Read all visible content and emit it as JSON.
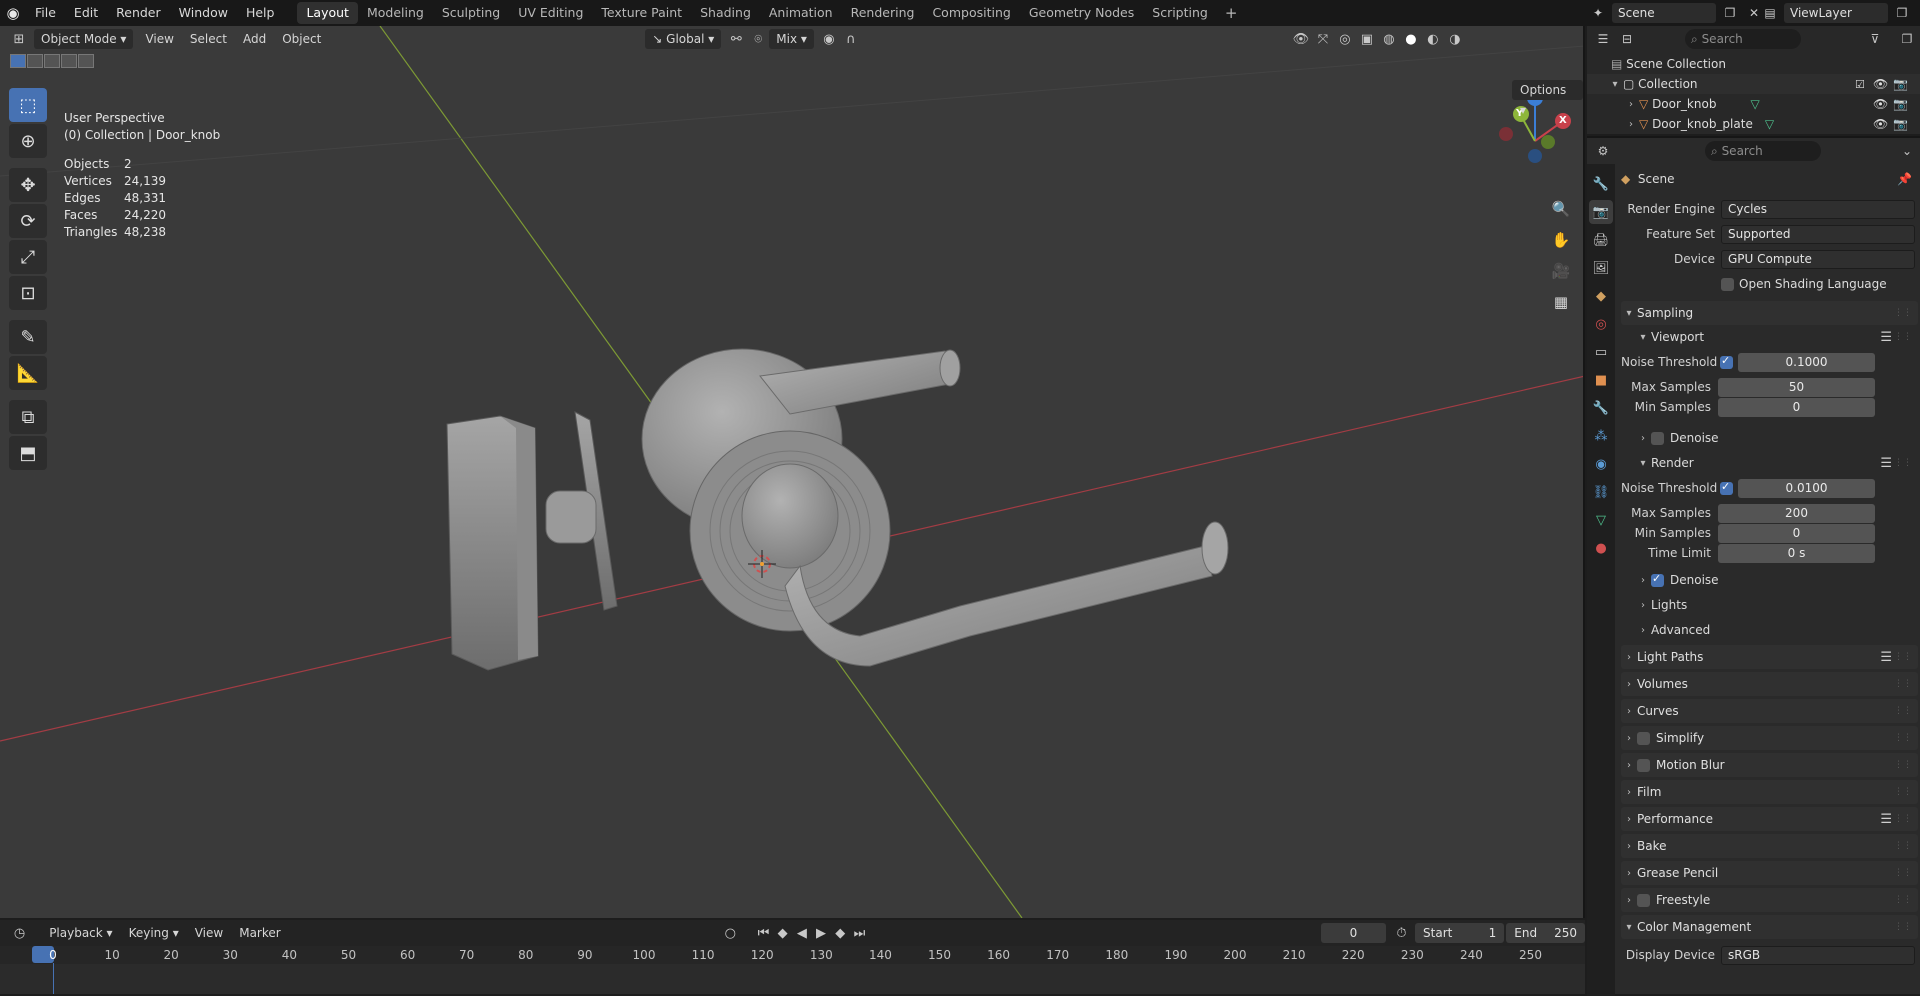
{
  "topbar": {
    "menus": [
      "File",
      "Edit",
      "Render",
      "Window",
      "Help"
    ],
    "workspaces": [
      "Layout",
      "Modeling",
      "Sculpting",
      "UV Editing",
      "Texture Paint",
      "Shading",
      "Animation",
      "Rendering",
      "Compositing",
      "Geometry Nodes",
      "Scripting"
    ],
    "active_workspace": "Layout",
    "add_symbol": "+",
    "scene_name": "Scene",
    "view_layer": "ViewLayer"
  },
  "viewport": {
    "mode": "Object Mode",
    "menus": [
      "View",
      "Select",
      "Add",
      "Object"
    ],
    "transform_orientation": "Global",
    "snap_target": "Mix",
    "options_label": "Options",
    "perspective": "User Perspective",
    "collection_path": "(0) Collection | Door_knob",
    "stats": [
      {
        "label": "Objects",
        "value": "2"
      },
      {
        "label": "Vertices",
        "value": "24,139"
      },
      {
        "label": "Edges",
        "value": "48,331"
      },
      {
        "label": "Faces",
        "value": "24,220"
      },
      {
        "label": "Triangles",
        "value": "48,238"
      }
    ],
    "gizmo_axes": {
      "x": "X",
      "y": "Y",
      "z": "Z"
    },
    "colors": {
      "x_axis": "#c8414b",
      "y_axis": "#8db63a",
      "z_axis": "#3b7ed6",
      "grid_bg": "#3a3a3a",
      "accent": "#4772b3"
    }
  },
  "timeline": {
    "menus": [
      "Playback",
      "Keying",
      "View",
      "Marker"
    ],
    "current_frame": "0",
    "start_label": "Start",
    "start_value": "1",
    "end_label": "End",
    "end_value": "250",
    "ticks": [
      "0",
      "10",
      "20",
      "30",
      "40",
      "50",
      "60",
      "70",
      "80",
      "90",
      "100",
      "110",
      "120",
      "130",
      "140",
      "150",
      "160",
      "170",
      "180",
      "190",
      "200",
      "210",
      "220",
      "230",
      "240",
      "250"
    ]
  },
  "outliner": {
    "search_placeholder": "Search",
    "root": "Scene Collection",
    "collection": "Collection",
    "objects": [
      "Door_knob",
      "Door_knob_plate"
    ]
  },
  "properties": {
    "search_placeholder": "Search",
    "context": "Scene",
    "render_engine": {
      "label": "Render Engine",
      "value": "Cycles"
    },
    "feature_set": {
      "label": "Feature Set",
      "value": "Supported"
    },
    "device": {
      "label": "Device",
      "value": "GPU Compute"
    },
    "osl_label": "Open Shading Language",
    "sampling": "Sampling",
    "viewport_panel": "Viewport",
    "vp_noise_label": "Noise Threshold",
    "vp_noise": "0.1000",
    "vp_max_label": "Max Samples",
    "vp_max": "50",
    "vp_min_label": "Min Samples",
    "vp_min": "0",
    "denoise_label": "Denoise",
    "render_panel": "Render",
    "r_noise_label": "Noise Threshold",
    "r_noise": "0.0100",
    "r_max_label": "Max Samples",
    "r_max": "200",
    "r_min_label": "Min Samples",
    "r_min": "0",
    "r_time_label": "Time Limit",
    "r_time": "0 s",
    "r_denoise_label": "Denoise",
    "lights": "Lights",
    "advanced": "Advanced",
    "panels": [
      "Light Paths",
      "Volumes",
      "Curves",
      "Simplify",
      "Motion Blur",
      "Film",
      "Performance",
      "Bake",
      "Grease Pencil",
      "Freestyle",
      "Color Management"
    ],
    "display_device_label": "Display Device",
    "display_device": "sRGB"
  }
}
